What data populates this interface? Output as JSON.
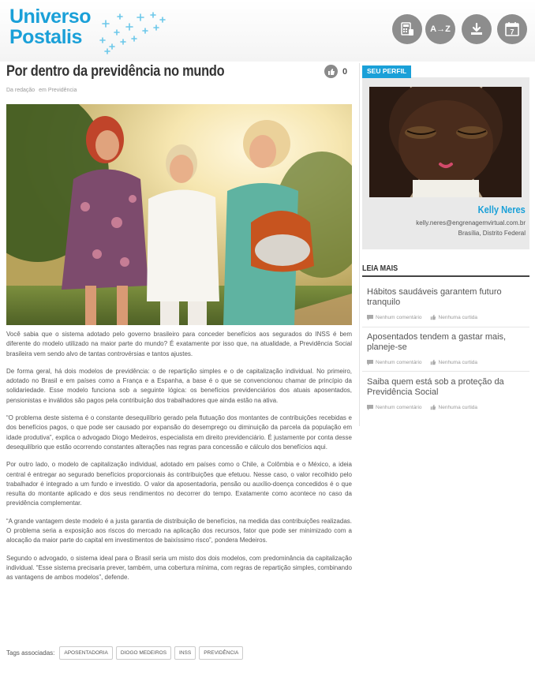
{
  "header": {
    "logo_line1": "Universo",
    "logo_line2": "Postalis",
    "brand_color": "#1aa0d8",
    "icons": [
      "calculator-icon",
      "glossary-az-icon",
      "download-icon",
      "calendar-icon"
    ],
    "az_label": "A→Z",
    "calendar_day": "7"
  },
  "article": {
    "title": "Por dentro da previdência no mundo",
    "likes": "0",
    "byline_author": "Da redação",
    "byline_category": "em Previdência",
    "paragraphs": [
      "Você sabia que o sistema adotado pelo governo brasileiro para conceder benefícios aos segurados do INSS é bem diferente do modelo utilizado na maior parte do mundo? É exatamente por isso que, na atualidade, a Previdência Social brasileira vem sendo alvo de tantas controvérsias e tantos ajustes.",
      "De forma geral, há dois modelos de previdência: o de repartição simples e o de capitalização individual. No primeiro, adotado no Brasil e em países como a França e a Espanha, a base é o que se convencionou chamar de princípio da solidariedade. Esse modelo funciona sob a seguinte lógica: os benefícios previdenciários dos atuais aposentados, pensionistas e inválidos são pagos pela contribuição dos trabalhadores que ainda estão na ativa.",
      "“O problema deste sistema é o constante desequilíbrio gerado pela flutuação dos montantes de contribuições recebidas e dos benefícios pagos, o que pode ser causado por expansão do desemprego ou diminuição da parcela da população em idade produtiva”, explica o advogado Diogo Medeiros, especialista em direito previdenciário. É justamente por conta desse desequilíbrio que estão ocorrendo constantes alterações nas regras para concessão e cálculo dos benefícios aqui.",
      "Por outro lado, o modelo de capitalização individual, adotado em países como o Chile, a Colômbia e o México, a ideia central é entregar ao segurado benefícios proporcionais às contribuições que efetuou. Nesse caso, o valor recolhido pelo trabalhador é integrado a um fundo e investido. O valor da aposentadoria, pensão ou auxílio-doença concedidos é o que resulta do montante aplicado e dos seus rendimentos no decorrer do tempo. Exatamente como acontece no caso da previdência complementar.",
      "“A grande vantagem deste modelo é a justa garantia de distribuição de benefícios, na medida das contribuições realizadas. O problema seria a exposição aos riscos do mercado na aplicação dos recursos, fator que pode ser minimizado com a alocação da maior parte do capital em investimentos de baixíssimo risco”, pondera Medeiros.",
      "Segundo o advogado, o sistema ideal para o Brasil seria um misto dos dois modelos, com predominância da capitalização individual. “Esse sistema precisaria prever, também, uma cobertura mínima, com regras de repartição simples, combinando as vantagens de ambos modelos”, defende."
    ],
    "tags_label": "Tags associadas:",
    "tags": [
      "APOSENTADORIA",
      "DIOGO MEDEIROS",
      "INSS",
      "PREVIDÊNCIA"
    ]
  },
  "profile": {
    "section_title": "SEU PERFIL",
    "name": "Kelly Neres",
    "email": "kelly.neres@engrenagemvirtual.com.br",
    "location": "Brasília, Distrito Federal"
  },
  "leia_mais": {
    "title": "LEIA MAIS",
    "items": [
      {
        "title": "Hábitos saudáveis garantem futuro tranquilo",
        "comments": "Nenhum comentário",
        "likes": "Nenhuma curtida"
      },
      {
        "title": "Aposentados tendem a gastar mais, planeje-se",
        "comments": "Nenhum comentário",
        "likes": "Nenhuma curtida"
      },
      {
        "title": "Saiba quem está sob a proteção da Previdência Social",
        "comments": "Nenhum comentário",
        "likes": "Nenhuma curtida"
      }
    ]
  }
}
